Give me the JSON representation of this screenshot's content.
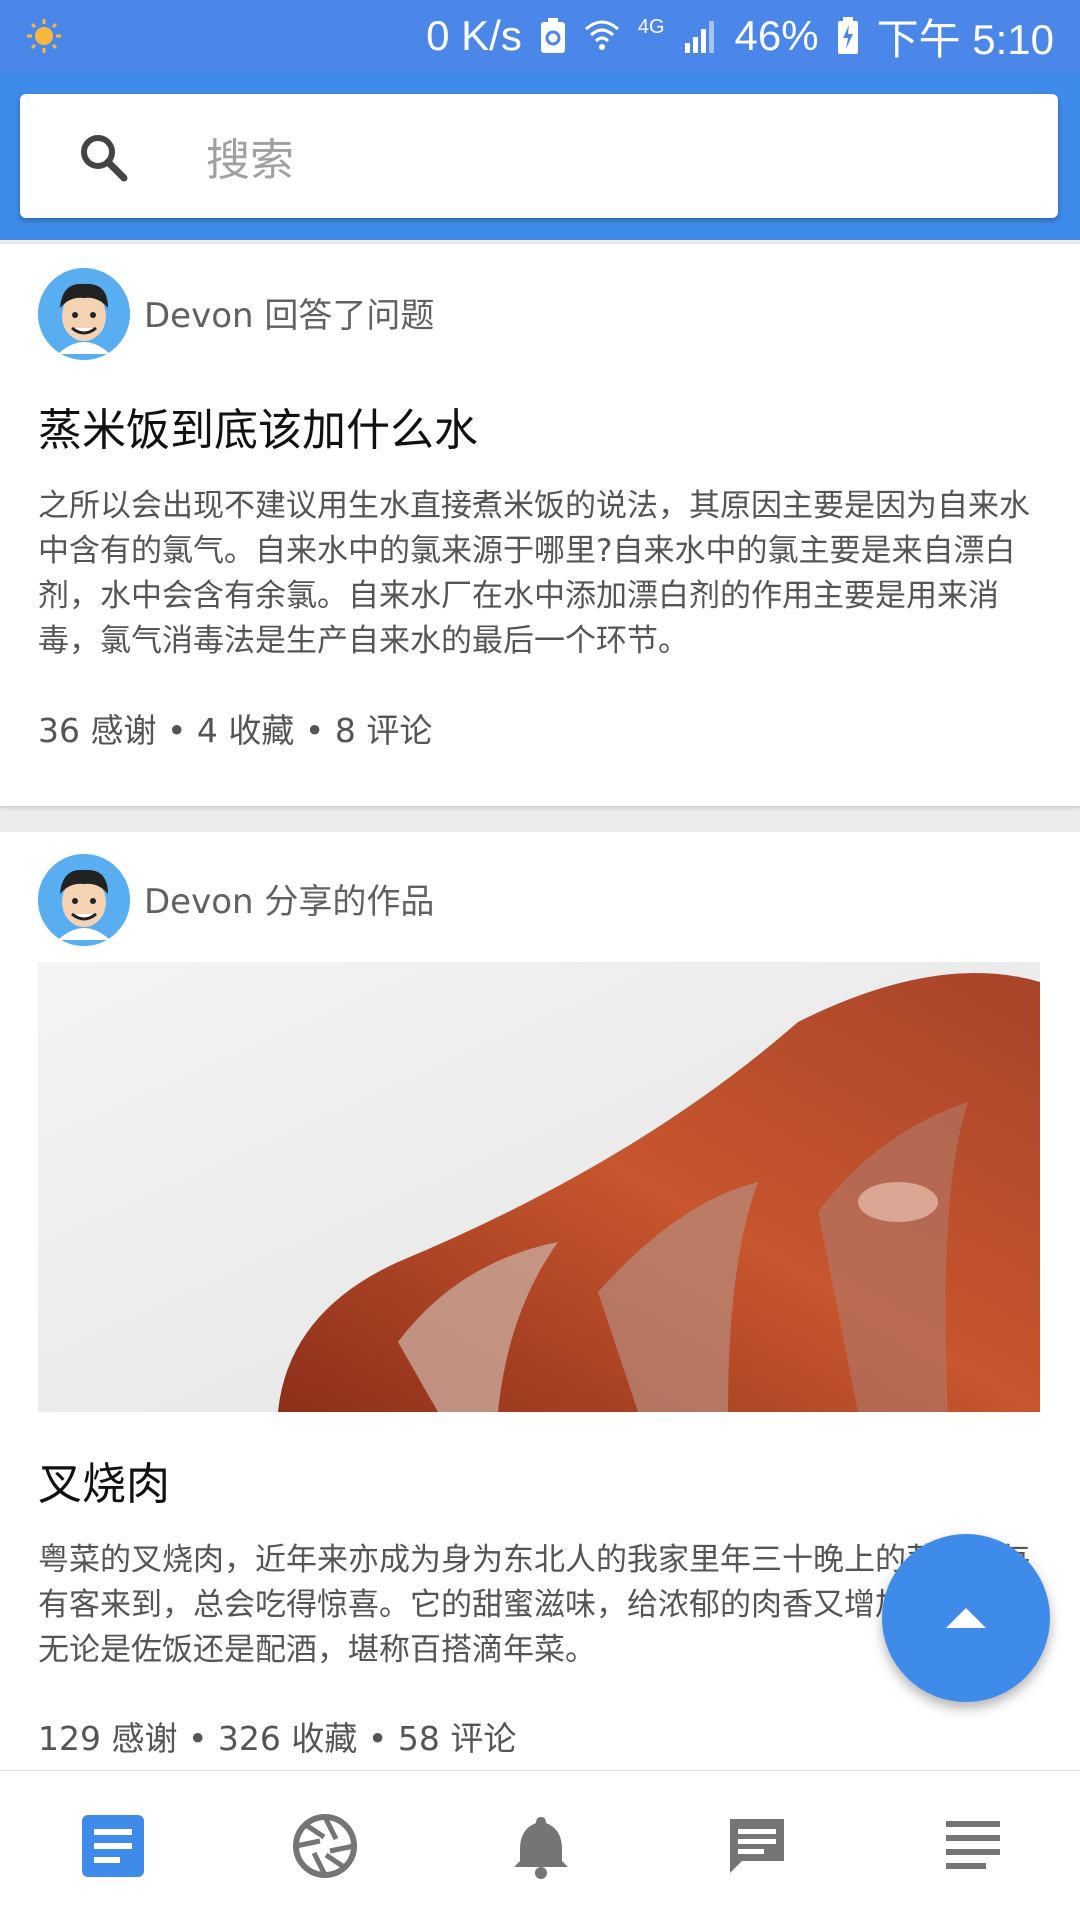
{
  "status_bar": {
    "net_speed": "0 K/s",
    "network_type": "4G",
    "battery": "46%",
    "time": "下午 5:10"
  },
  "search": {
    "placeholder": "搜索"
  },
  "feed": [
    {
      "author_action": "Devon 回答了问题",
      "title": "蒸米饭到底该加什么水",
      "body": "之所以会出现不建议用生水直接煮米饭的说法，其原因主要是因为自来水中含有的氯气。自来水中的氯来源于哪里?自来水中的氯主要是来自漂白剂，水中会含有余氯。自来水厂在水中添加漂白剂的作用主要是用来消毒，氯气消毒法是生产自来水的最后一个环节。",
      "stats": "36 感谢 • 4 收藏 • 8 评论"
    },
    {
      "author_action": "Devon 分享的作品",
      "title": "叉烧肉",
      "body": "粤菜的叉烧肉，近年来亦成为身为东北人的我家里年三十晚上的菜，每每有客来到，总会吃得惊喜。它的甜蜜滋味，给浓郁的肉香又增加了甜味，无论是佐饭还是配酒，堪称百搭滴年菜。",
      "stats": "129 感谢 • 326 收藏 • 58 评论"
    }
  ],
  "bottom_nav": [
    "article-icon",
    "camera-shutter-icon",
    "bell-icon",
    "chat-icon",
    "menu-lines-icon"
  ],
  "colors": {
    "primary": "#3f8bea",
    "status_bar": "#4a87e8",
    "nav_active": "#3f8bea",
    "nav_inactive": "#757575"
  }
}
